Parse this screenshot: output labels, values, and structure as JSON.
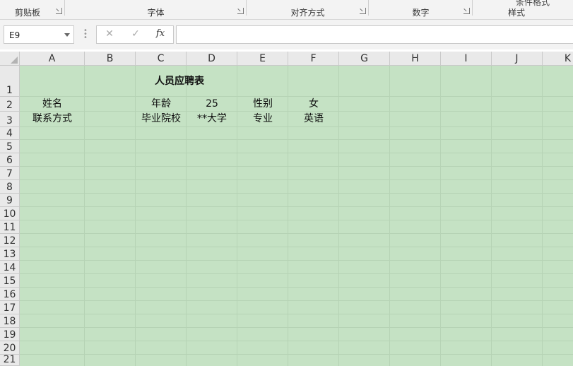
{
  "ribbon": {
    "groups": [
      "剪贴板",
      "字体",
      "对齐方式",
      "数字",
      "样式"
    ],
    "cutoff_text": "条件格式"
  },
  "formula_bar": {
    "name_box": "E9",
    "formula": "",
    "cancel_icon": "✕",
    "enter_icon": "✓",
    "fx_label": "fx"
  },
  "sheet": {
    "columns": [
      "A",
      "B",
      "C",
      "D",
      "E",
      "F",
      "G",
      "H",
      "I",
      "J",
      "K"
    ],
    "rows": [
      "1",
      "2",
      "3",
      "4",
      "5",
      "6",
      "7",
      "8",
      "9",
      "10",
      "11",
      "12",
      "13",
      "14",
      "15",
      "16",
      "17",
      "18",
      "19",
      "20",
      "21"
    ],
    "title": "人员应聘表",
    "cells": {
      "A2": "姓名",
      "C2": "年龄",
      "D2": "25",
      "E2": "性别",
      "F2": "女",
      "A3": "联系方式",
      "C3": "毕业院校",
      "D3": "**大学",
      "E3": "专业",
      "F3": "英语"
    },
    "fill_color": "#c5e2c4"
  }
}
